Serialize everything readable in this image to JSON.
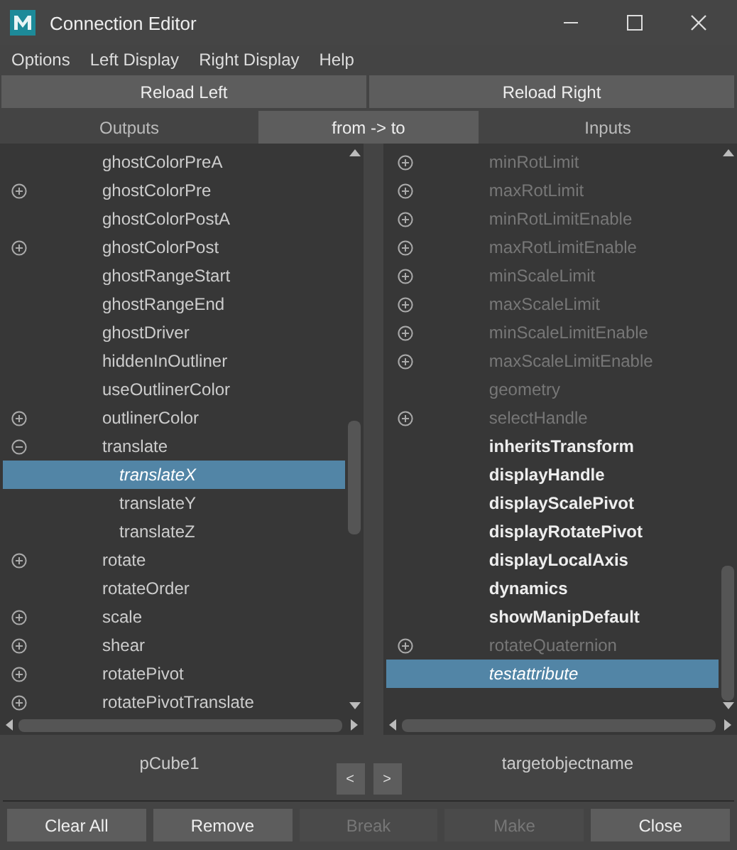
{
  "window": {
    "title": "Connection Editor"
  },
  "menu": [
    "Options",
    "Left Display",
    "Right Display",
    "Help"
  ],
  "reload_buttons": [
    "Reload Left",
    "Reload Right"
  ],
  "headers": [
    {
      "label": "Outputs",
      "selected": false
    },
    {
      "label": "from -> to",
      "selected": true
    },
    {
      "label": "Inputs",
      "selected": false
    }
  ],
  "left_list": [
    {
      "name": "ghostColorPreA",
      "selected": false
    },
    {
      "name": "ghostColorPre",
      "selected": false,
      "expanded": false
    },
    {
      "name": "ghostColorPostA",
      "selected": false
    },
    {
      "name": "ghostColorPost",
      "selected": false,
      "expanded": false
    },
    {
      "name": "ghostRangeStart",
      "selected": false
    },
    {
      "name": "ghostRangeEnd",
      "selected": false
    },
    {
      "name": "ghostDriver",
      "selected": false
    },
    {
      "name": "hiddenInOutliner",
      "selected": false
    },
    {
      "name": "useOutlinerColor",
      "selected": false
    },
    {
      "name": "outlinerColor",
      "selected": false,
      "expanded": false
    },
    {
      "name": "translate",
      "selected": false,
      "expanded": true,
      "children": [
        {
          "name": "translateX",
          "selected": true
        },
        {
          "name": "translateY",
          "selected": false
        },
        {
          "name": "translateZ",
          "selected": false
        }
      ]
    },
    {
      "name": "rotate",
      "selected": false,
      "expanded": false
    },
    {
      "name": "rotateOrder",
      "selected": false
    },
    {
      "name": "scale",
      "selected": false,
      "expanded": false
    },
    {
      "name": "shear",
      "selected": false,
      "expanded": false
    },
    {
      "name": "rotatePivot",
      "selected": false,
      "expanded": false
    },
    {
      "name": "rotatePivotTranslate",
      "selected": false,
      "expanded": false
    }
  ],
  "right_list": [
    {
      "name": "minRotLimit",
      "kind": "dim",
      "selected": false,
      "expanded": false
    },
    {
      "name": "maxRotLimit",
      "kind": "dim",
      "selected": false,
      "expanded": false
    },
    {
      "name": "minRotLimitEnable",
      "kind": "dim",
      "selected": false,
      "expanded": false
    },
    {
      "name": "maxRotLimitEnable",
      "kind": "dim",
      "selected": false,
      "expanded": false
    },
    {
      "name": "minScaleLimit",
      "kind": "dim",
      "selected": false,
      "expanded": false
    },
    {
      "name": "maxScaleLimit",
      "kind": "dim",
      "selected": false,
      "expanded": false
    },
    {
      "name": "minScaleLimitEnable",
      "kind": "dim",
      "selected": false,
      "expanded": false
    },
    {
      "name": "maxScaleLimitEnable",
      "kind": "dim",
      "selected": false,
      "expanded": false
    },
    {
      "name": "geometry",
      "kind": "dim",
      "selected": false
    },
    {
      "name": "selectHandle",
      "kind": "dim",
      "selected": false,
      "expanded": false
    },
    {
      "name": "inheritsTransform",
      "kind": "bold",
      "selected": false
    },
    {
      "name": "displayHandle",
      "kind": "bold",
      "selected": false
    },
    {
      "name": "displayScalePivot",
      "kind": "bold",
      "selected": false
    },
    {
      "name": "displayRotatePivot",
      "kind": "bold",
      "selected": false
    },
    {
      "name": "displayLocalAxis",
      "kind": "bold",
      "selected": false
    },
    {
      "name": "dynamics",
      "kind": "bold",
      "selected": false
    },
    {
      "name": "showManipDefault",
      "kind": "bold",
      "selected": false
    },
    {
      "name": "rotateQuaternion",
      "kind": "dim",
      "selected": false,
      "expanded": false
    },
    {
      "name": "testattribute",
      "kind": "normal",
      "selected": true
    }
  ],
  "left_object": "pCube1",
  "right_object": "targetobjectname",
  "arrows": [
    "<",
    ">"
  ],
  "buttons": [
    {
      "label": "Clear All",
      "disabled": false
    },
    {
      "label": "Remove",
      "disabled": false
    },
    {
      "label": "Break",
      "disabled": true
    },
    {
      "label": "Make",
      "disabled": true
    },
    {
      "label": "Close",
      "disabled": false
    }
  ]
}
